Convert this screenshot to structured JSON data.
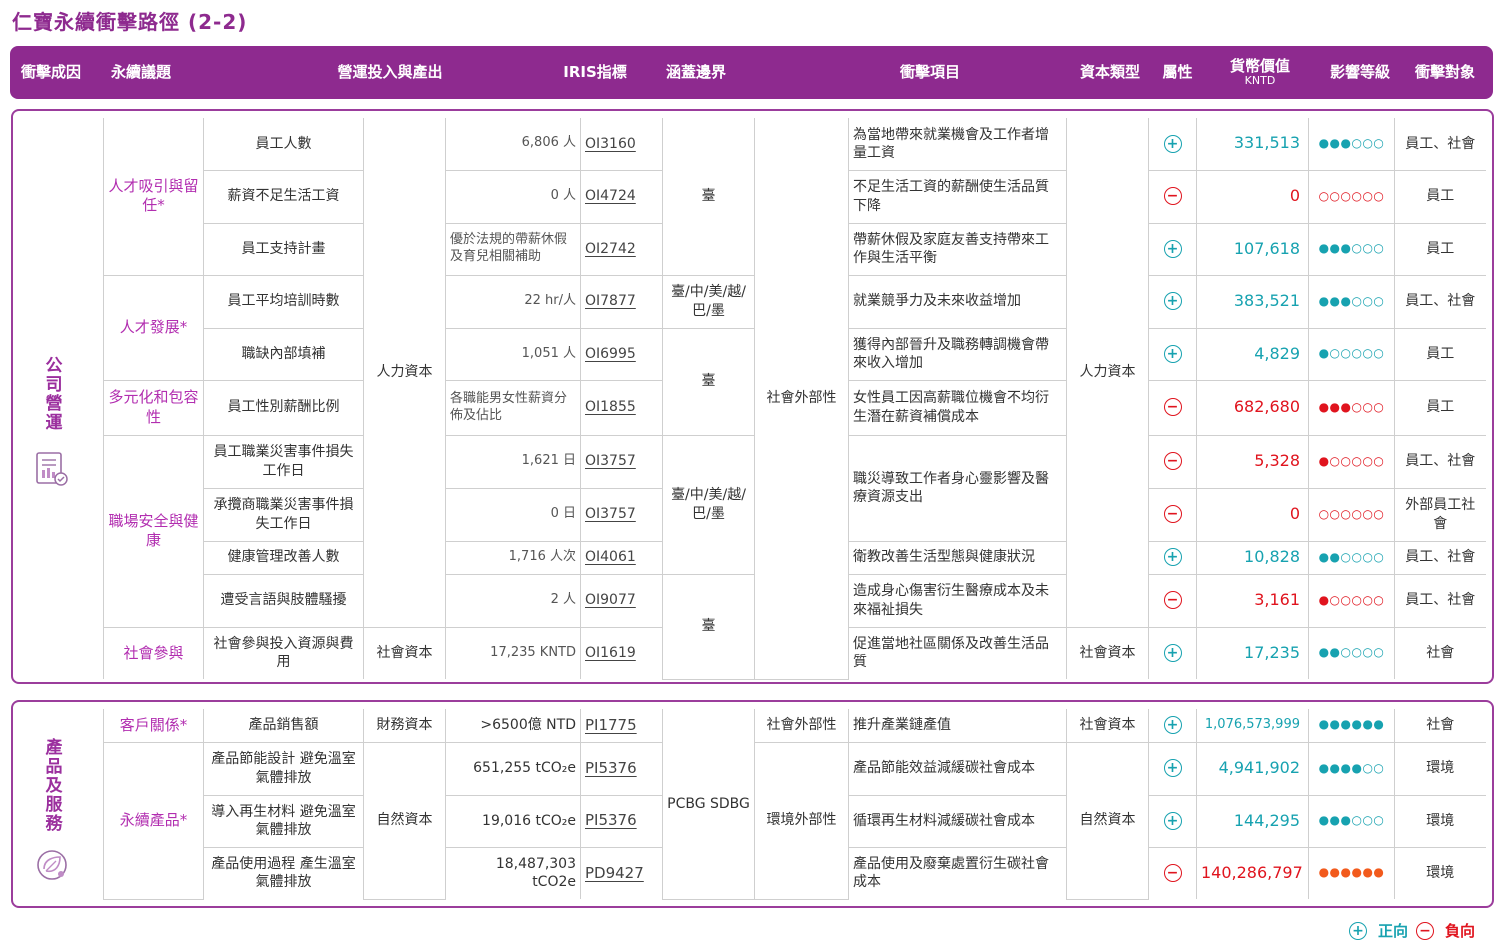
{
  "title": "仁寶永續衝擊路徑 (2-2)",
  "headers": {
    "cause": "衝擊成因",
    "topic": "永續議題",
    "ops": "營運投入與產出",
    "iris": "IRIS指標",
    "boundary": "涵蓋邊界",
    "item": "衝擊項目",
    "capital": "資本類型",
    "attr": "屬性",
    "value": "貨幣價值",
    "value_sub": "KNTD",
    "level": "影響等級",
    "target": "衝擊對象"
  },
  "colors": {
    "accent": "#8e2a8f",
    "positive": "#17a2b0",
    "negative": "#e0141e",
    "orange": "#f25a1c"
  },
  "section1": {
    "label": "公司營運",
    "icon": "report-chart-icon",
    "topics": [
      "人才吸引與留任*",
      "人才發展*",
      "多元化和包容性",
      "職場安全與健康",
      "社會參與"
    ],
    "capital_ops": [
      "人力資本",
      "社會資本"
    ],
    "boundaries": [
      "臺",
      "臺/中/美/越/巴/墨",
      "臺",
      "臺/中/美/越/巴/墨",
      "臺"
    ],
    "externality": "社會外部性",
    "capital_types": [
      "人力資本",
      "社會資本"
    ],
    "rows": [
      {
        "metric": "員工人數",
        "output": "6,806 人",
        "iris": "OI3160",
        "item": "為當地帶來就業機會及工作者增量工資",
        "sign": "+",
        "value": "331,513",
        "level": "●●●○○○",
        "target": "員工、社會"
      },
      {
        "metric": "薪資不足生活工資",
        "output": "0 人",
        "iris": "OI4724",
        "item": "不足生活工資的薪酬使生活品質下降",
        "sign": "−",
        "value": "0",
        "level": "○○○○○○",
        "target": "員工"
      },
      {
        "metric": "員工支持計畫",
        "output": "優於法規的帶薪休假及育兒相關補助",
        "iris": "OI2742",
        "item": "帶薪休假及家庭友善支持帶來工作與生活平衡",
        "sign": "+",
        "value": "107,618",
        "level": "●●●○○○",
        "target": "員工"
      },
      {
        "metric": "員工平均培訓時數",
        "output": "22 hr/人",
        "iris": "OI7877",
        "item": "就業競爭力及未來收益增加",
        "sign": "+",
        "value": "383,521",
        "level": "●●●○○○",
        "target": "員工、社會"
      },
      {
        "metric": "職缺內部填補",
        "output": "1,051 人",
        "iris": "OI6995",
        "item": "獲得內部晉升及職務轉調機會帶來收入增加",
        "sign": "+",
        "value": "4,829",
        "level": "●○○○○○",
        "target": "員工"
      },
      {
        "metric": "員工性別薪酬比例",
        "output": "各職能男女性薪資分佈及佔比",
        "iris": "OI1855",
        "item": "女性員工因高薪職位機會不均衍生潛在薪資補償成本",
        "sign": "−",
        "value": "682,680",
        "level": "●●●○○○",
        "target": "員工"
      },
      {
        "metric": "員工職業災害事件損失工作日",
        "output": "1,621 日",
        "iris": "OI3757",
        "item": "職災導致工作者身心靈影響及醫療資源支出",
        "sign": "−",
        "value": "5,328",
        "level": "●○○○○○",
        "target": "員工、社會"
      },
      {
        "metric": "承攬商職業災害事件損失工作日",
        "output": "0 日",
        "iris": "OI3757",
        "item": "",
        "sign": "−",
        "value": "0",
        "level": "○○○○○○",
        "target": "外部員工社會"
      },
      {
        "metric": "健康管理改善人數",
        "output": "1,716 人次",
        "iris": "OI4061",
        "item": "衛教改善生活型態與健康狀況",
        "sign": "+",
        "value": "10,828",
        "level": "●●○○○○",
        "target": "員工、社會"
      },
      {
        "metric": "遭受言語與肢體騷擾",
        "output": "2 人",
        "iris": "OI9077",
        "item": "造成身心傷害衍生醫療成本及未來福祉損失",
        "sign": "−",
        "value": "3,161",
        "level": "●○○○○○",
        "target": "員工、社會"
      },
      {
        "metric": "社會參與投入資源與費用",
        "output": "17,235 KNTD",
        "iris": "OI1619",
        "item": "促進當地社區關係及改善生活品質",
        "sign": "+",
        "value": "17,235",
        "level": "●●○○○○",
        "target": "社會"
      }
    ]
  },
  "section2": {
    "label": "產品及服務",
    "icon": "eco-leaf-globe-icon",
    "topics": [
      "客戶關係*",
      "永續產品*"
    ],
    "capital_ops": [
      "財務資本",
      "自然資本"
    ],
    "boundary": "PCBG SDBG",
    "externalities": [
      "社會外部性",
      "環境外部性"
    ],
    "capital_types": [
      "社會資本",
      "自然資本"
    ],
    "rows": [
      {
        "metric": "產品銷售額",
        "output": ">6500億 NTD",
        "iris": "PI1775",
        "item": "推升產業鏈產值",
        "sign": "+",
        "value": "1,076,573,999",
        "level": "●●●●●●",
        "target": "社會"
      },
      {
        "metric": "產品節能設計 避免溫室氣體排放",
        "output": "651,255 tCO₂e",
        "iris": "PI5376",
        "item": "產品節能效益減緩碳社會成本",
        "sign": "+",
        "value": "4,941,902",
        "level": "●●●●○○",
        "target": "環境"
      },
      {
        "metric": "導入再生材料 避免溫室氣體排放",
        "output": "19,016 tCO₂e",
        "iris": "PI5376",
        "item": "循環再生材料減緩碳社會成本",
        "sign": "+",
        "value": "144,295",
        "level": "●●●○○○",
        "target": "環境"
      },
      {
        "metric": "產品使用過程 產生溫室氣體排放",
        "output": "18,487,303 tCO2e",
        "iris": "PD9427",
        "item": "產品使用及廢棄處置衍生碳社會成本",
        "sign": "−",
        "value": "140,286,797",
        "level": "●●●●●●",
        "target": "環境"
      }
    ]
  },
  "legend": {
    "positive": "正向",
    "negative": "負向"
  }
}
